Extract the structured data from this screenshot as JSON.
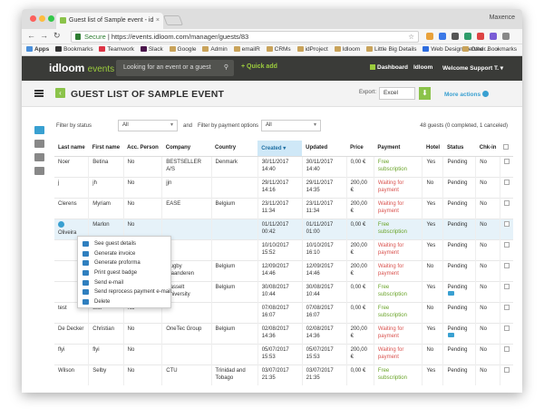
{
  "browser": {
    "tab_title": "Guest list of Sample event - id",
    "tab_close": "×",
    "user": "Maxence",
    "back": "←",
    "forward": "→",
    "reload": "↻",
    "secure_label": "Secure",
    "url": "https://events.idloom.com/manager/guests/83",
    "star": "☆",
    "bookmarks": [
      "Apps",
      "Bookmarks",
      "Teamwork",
      "Slack",
      "Google",
      "Admin",
      "emailR",
      "CRMs",
      "idProject",
      "Idloom",
      "Little Big Details",
      "Web Design Served ..."
    ],
    "bookmarks_more": "»",
    "other_bookmarks": "Other Bookmarks"
  },
  "topnav": {
    "logo_main": "idloom",
    "logo_sub": "events",
    "search_placeholder": "Looking for an event or a guest",
    "search_icon": "⚲",
    "quick_add": "+ Quick add",
    "dashboard": "Dashboard",
    "idloom": "Idloom",
    "welcome": "Welcome Support T. ▾"
  },
  "header": {
    "back_icon": "‹",
    "title": "GUEST LIST OF SAMPLE EVENT",
    "export_label": "Export:",
    "export_value": "Excel",
    "export_button": "⬇",
    "more_actions": "More actions"
  },
  "filters": {
    "status_label": "Filter by status",
    "status_value": "All",
    "and": "and",
    "payment_label": "Filter by payment options",
    "payment_value": "All",
    "count": "48 guests (0 completed, 1 canceled)"
  },
  "columns": [
    "Last name",
    "First name",
    "Acc. Person",
    "Company",
    "Country",
    "Created ▾",
    "Updated",
    "Price",
    "Payment",
    "Hotel",
    "Status",
    "Chk-in"
  ],
  "rows": [
    {
      "last": "Noer",
      "first": "Betina",
      "acc": "No",
      "company": "BESTSELLER A/S",
      "country": "Denmark",
      "created": "30/11/2017 14:40",
      "updated": "30/11/2017 14:40",
      "price": "0,00 €",
      "payment": "Free subscription",
      "pay_color": "green",
      "hotel": "Yes",
      "status": "Pending",
      "chk": "No"
    },
    {
      "last": "j",
      "first": "jh",
      "acc": "No",
      "company": "jjn",
      "country": "",
      "created": "29/11/2017 14:16",
      "updated": "29/11/2017 14:35",
      "price": "200,00 €",
      "payment": "Waiting for payment",
      "pay_color": "red",
      "hotel": "No",
      "status": "Pending",
      "chk": "No"
    },
    {
      "last": "Clerens",
      "first": "Myriam",
      "acc": "No",
      "company": "EASE",
      "country": "Belgium",
      "created": "23/11/2017 11:34",
      "updated": "23/11/2017 11:34",
      "price": "200,00 €",
      "payment": "Waiting for payment",
      "pay_color": "red",
      "hotel": "Yes",
      "status": "Pending",
      "chk": "No"
    },
    {
      "last": "Oliveira",
      "first": "Marlon",
      "acc": "No",
      "company": "",
      "country": "",
      "created": "01/11/2017 00:42",
      "updated": "01/11/2017 01:00",
      "price": "0,00 €",
      "payment": "Free subscription",
      "pay_color": "green",
      "hotel": "Yes",
      "status": "Pending",
      "chk": "No"
    },
    {
      "last": "",
      "first": "",
      "acc": "",
      "company": "",
      "country": "",
      "created": "10/10/2017 15:52",
      "updated": "10/10/2017 16:10",
      "price": "200,00 €",
      "payment": "Waiting for payment",
      "pay_color": "red",
      "hotel": "Yes",
      "status": "Pending",
      "chk": "No"
    },
    {
      "last": "",
      "first": "",
      "acc": "",
      "company": "Rugby Vlaanderen",
      "country": "Belgium",
      "created": "12/09/2017 14:46",
      "updated": "12/09/2017 14:46",
      "price": "200,00 €",
      "payment": "Waiting for payment",
      "pay_color": "red",
      "hotel": "No",
      "status": "Pending",
      "chk": "No"
    },
    {
      "last": "",
      "first": "",
      "acc": "",
      "company": "Hasselt University",
      "country": "Belgium",
      "created": "30/08/2017 10:44",
      "updated": "30/08/2017 10:44",
      "price": "0,00 €",
      "payment": "Free subscription",
      "pay_color": "green",
      "hotel": "Yes",
      "status": "Pending",
      "chk": "No"
    },
    {
      "last": "test",
      "first": "test",
      "acc": "No",
      "company": "",
      "country": "",
      "created": "07/08/2017 16:07",
      "updated": "07/08/2017 16:07",
      "price": "0,00 €",
      "payment": "Free subscription",
      "pay_color": "green",
      "hotel": "No",
      "status": "Pending",
      "chk": "No"
    },
    {
      "last": "De Decker",
      "first": "Christian",
      "acc": "No",
      "company": "OneTec Group",
      "country": "Belgium",
      "created": "02/08/2017 14:36",
      "updated": "02/08/2017 14:36",
      "price": "200,00 €",
      "payment": "Waiting for payment",
      "pay_color": "red",
      "hotel": "Yes",
      "status": "Pending",
      "chk": "No"
    },
    {
      "last": "flyi",
      "first": "flyi",
      "acc": "No",
      "company": "",
      "country": "",
      "created": "05/07/2017 15:53",
      "updated": "05/07/2017 15:53",
      "price": "200,00 €",
      "payment": "Waiting for payment",
      "pay_color": "red",
      "hotel": "No",
      "status": "Pending",
      "chk": "No"
    },
    {
      "last": "Wilson",
      "first": "Selby",
      "acc": "No",
      "company": "CTU",
      "country": "Trinidad and Tobago",
      "created": "03/07/2017 21:35",
      "updated": "03/07/2017 21:35",
      "price": "0,00 €",
      "payment": "Free subscription",
      "pay_color": "green",
      "hotel": "Yes",
      "status": "Pending",
      "chk": "No"
    }
  ],
  "context_menu": [
    "See guest details",
    "Generate invoice",
    "Generate proforma",
    "Print guest badge",
    "Send e-mail",
    "Send reprocess payment e-mail",
    "Delete"
  ],
  "colors": {
    "accent": "#8bc34a",
    "link": "#39a0d1",
    "waiting": "#d9534f",
    "free": "#6aa429",
    "topbar": "#3a3b38"
  }
}
